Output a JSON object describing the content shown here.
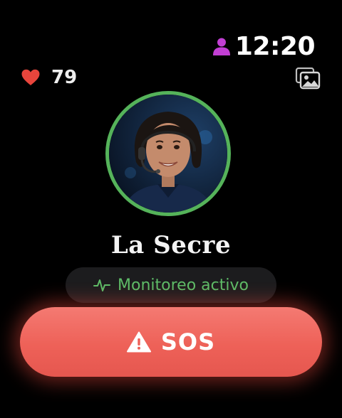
{
  "status": {
    "time": "12:20",
    "user_icon": "person-icon",
    "user_icon_color": "#c23fd4"
  },
  "health": {
    "heart_icon": "heart-icon",
    "heart_rate": "79",
    "heart_color": "#e8453c"
  },
  "gallery": {
    "icon": "photo-gallery-icon"
  },
  "contact": {
    "avatar_icon": "agent-avatar",
    "name": "La Secre",
    "ring_color": "#55b35a"
  },
  "monitor": {
    "icon": "pulse-icon",
    "label": "Monitoreo activo",
    "color": "#5ebd68"
  },
  "sos": {
    "icon": "warning-icon",
    "label": "SOS",
    "color": "#ee6158"
  }
}
